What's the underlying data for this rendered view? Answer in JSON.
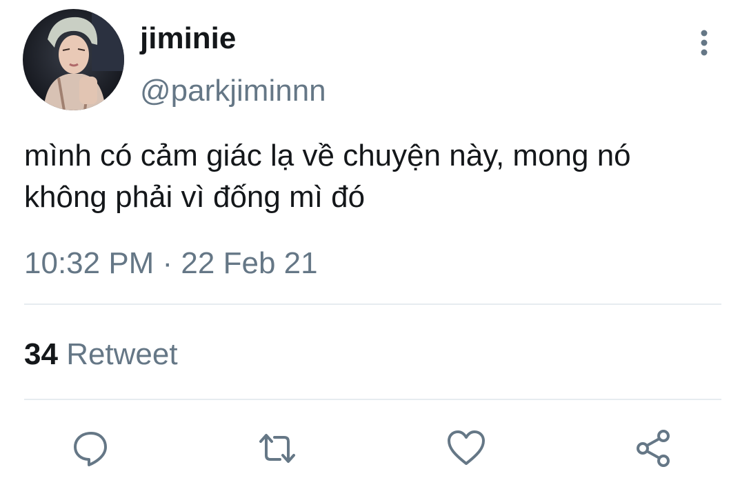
{
  "tweet": {
    "display_name": "jiminie",
    "handle": "@parkjiminnn",
    "text": "mình có cảm giác lạ về chuyện này, mong nó\nkhông phải vì đống mì đó",
    "timestamp": "10:32 PM · 22 Feb 21",
    "retweet_count": "34",
    "retweet_label": "Retweet"
  },
  "icons": {
    "more": "more-vertical-icon",
    "reply": "reply-icon",
    "retweet": "retweet-icon",
    "like": "heart-icon",
    "share": "share-icon"
  },
  "colors": {
    "text_primary": "#14171a",
    "text_secondary": "#657786",
    "icon": "#657786",
    "divider": "#e6ecf0"
  }
}
